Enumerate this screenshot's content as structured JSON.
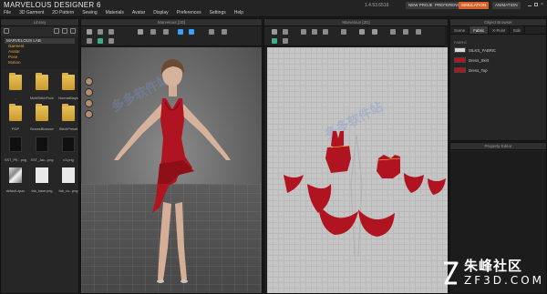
{
  "app": {
    "logo_text": "MARVELOUS DESIGNER 6",
    "version": "1.4.53.6516",
    "menu": [
      "File",
      "3D Garment",
      "2D Pattern",
      "Sewing",
      "Materials",
      "Avatar",
      "Display",
      "Preferences",
      "Settings",
      "Help"
    ],
    "buttons": {
      "new_project": "NEW PROJECT",
      "preferences": "PREFERENCE",
      "simulation": "SIMULATION",
      "animation": "ANIMATION"
    }
  },
  "library": {
    "title": "Library",
    "tree_header": "MARVELOUS LAB",
    "tree_items": [
      "Garment",
      "Avatar",
      "Pose",
      "Motion"
    ],
    "items": [
      {
        "caption": "..",
        "kind": "folder"
      },
      {
        "caption": "MultiStitchPocke",
        "kind": "folder"
      },
      {
        "caption": "NormalMaps",
        "kind": "folder"
      },
      {
        "caption": "PGP",
        "kind": "folder"
      },
      {
        "caption": "SeamsBlossoms",
        "kind": "folder"
      },
      {
        "caption": "StitchPreset",
        "kind": "folder"
      },
      {
        "caption": "SST_PK...png",
        "kind": "image"
      },
      {
        "caption": "SST_Jac...png",
        "kind": "image"
      },
      {
        "caption": "x3.png",
        "kind": "image"
      },
      {
        "caption": "default.zpac",
        "kind": "fabric"
      },
      {
        "caption": "fab_base.png",
        "kind": "doc"
      },
      {
        "caption": "fab_co...png",
        "kind": "doc"
      }
    ]
  },
  "view3d": {
    "title": "Marvelous [3D]"
  },
  "view2d": {
    "title": "Marvelous [2D]"
  },
  "object_browser": {
    "title": "Object Browser",
    "tabs": [
      "Scene",
      "Fabric",
      "X-Point",
      "Edit"
    ],
    "active_tab": "Fabric",
    "header": "FABRIC",
    "fabrics": [
      {
        "name": "SILKS_FABRIC",
        "color": "#d8d8d8"
      },
      {
        "name": "Dress_Skirt",
        "color": "#b8141e"
      },
      {
        "name": "Dress_Top",
        "color": "#b8141e"
      }
    ]
  },
  "property_editor": {
    "title": "Property Editor"
  },
  "watermark": {
    "cn_text": "朱峰社区",
    "domain": "ZF3D.COM",
    "diagonal": "多多软件站"
  },
  "colors": {
    "dress_red": "#b01420",
    "accent_orange": "#d6622a",
    "folder_yellow": "#e0b24a"
  }
}
